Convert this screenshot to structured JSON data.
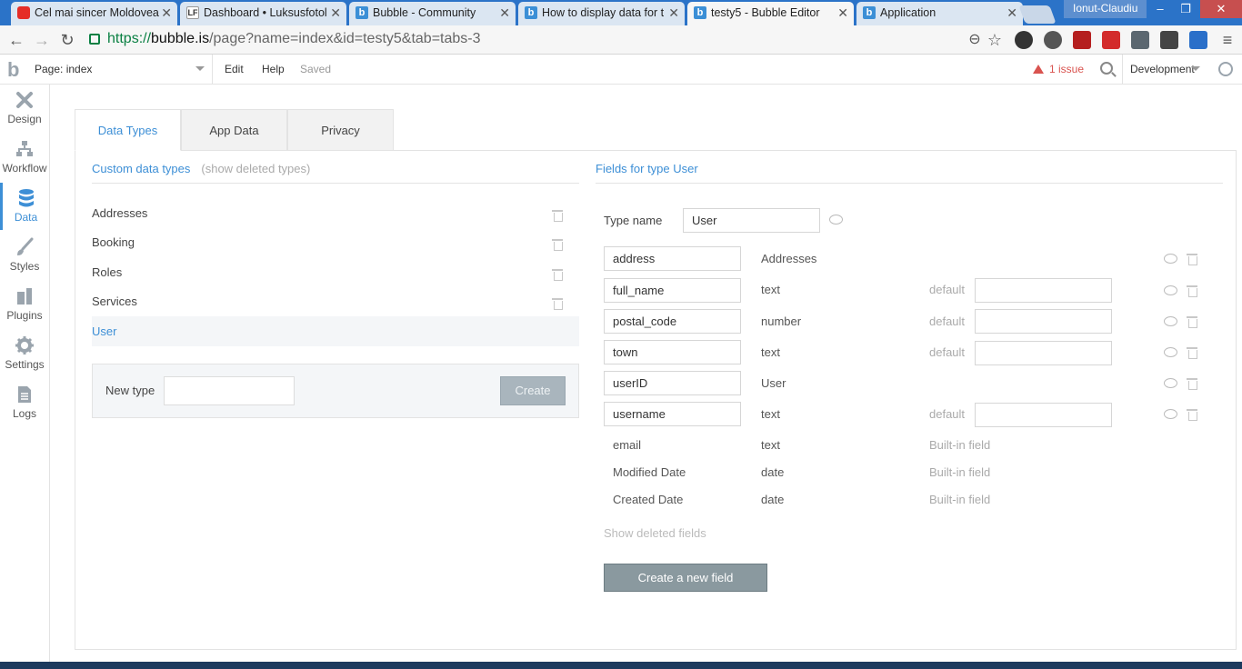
{
  "browser": {
    "tabs": [
      {
        "title": "Cel mai sincer Moldovea",
        "favicon": "youtube-icon"
      },
      {
        "title": "Dashboard • Luksusfotol",
        "favicon": "lf-icon"
      },
      {
        "title": "Bubble - Community",
        "favicon": "bubble-icon"
      },
      {
        "title": "How to display data for t",
        "favicon": "bubble-icon"
      },
      {
        "title": "testy5 - Bubble Editor",
        "favicon": "bubble-icon",
        "active": true
      },
      {
        "title": "Application",
        "favicon": "bubble-icon"
      }
    ],
    "profile_name": "Ionut-Claudiu",
    "url_scheme": "https://",
    "url_host": "bubble.is",
    "url_rest": "/page?name=index&id=testy5&tab=tabs-3"
  },
  "header": {
    "page_selector": "Page: index",
    "menu_edit": "Edit",
    "menu_help": "Help",
    "status": "Saved",
    "issues": "1 issue",
    "environment": "Development"
  },
  "sidebar": {
    "items": [
      {
        "label": "Design",
        "icon": "design-icon"
      },
      {
        "label": "Workflow",
        "icon": "workflow-icon"
      },
      {
        "label": "Data",
        "icon": "database-icon",
        "active": true
      },
      {
        "label": "Styles",
        "icon": "brush-icon"
      },
      {
        "label": "Plugins",
        "icon": "plugins-icon"
      },
      {
        "label": "Settings",
        "icon": "gear-icon"
      },
      {
        "label": "Logs",
        "icon": "logs-icon"
      }
    ]
  },
  "main": {
    "tabs": [
      "Data Types",
      "App Data",
      "Privacy"
    ],
    "active_tab": "Data Types",
    "left": {
      "heading": "Custom data types",
      "show_deleted": "(show deleted types)",
      "types": [
        "Addresses",
        "Booking",
        "Roles",
        "Services",
        "User"
      ],
      "selected_type": "User",
      "new_type_label": "New type",
      "new_type_value": "",
      "create_button": "Create"
    },
    "right": {
      "heading": "Fields for type User",
      "type_name_label": "Type name",
      "type_name_value": "User",
      "fields": [
        {
          "name": "address",
          "type": "Addresses",
          "default_label": "",
          "has_default": false
        },
        {
          "name": "full_name",
          "type": "text",
          "default_label": "default",
          "has_default": true
        },
        {
          "name": "postal_code",
          "type": "number",
          "default_label": "default",
          "has_default": true
        },
        {
          "name": "town",
          "type": "text",
          "default_label": "default",
          "has_default": true
        },
        {
          "name": "userID",
          "type": "User",
          "default_label": "",
          "has_default": false
        },
        {
          "name": "username",
          "type": "text",
          "default_label": "default",
          "has_default": true
        }
      ],
      "builtin_fields": [
        {
          "name": "email",
          "type": "text",
          "note": "Built-in field"
        },
        {
          "name": "Modified Date",
          "type": "date",
          "note": "Built-in field"
        },
        {
          "name": "Created Date",
          "type": "date",
          "note": "Built-in field"
        }
      ],
      "show_deleted_fields": "Show deleted fields",
      "create_field_button": "Create a new field"
    }
  },
  "colors": {
    "accent": "#3d8fd6",
    "browser_frame": "#2b73c8",
    "issue": "#d9534f",
    "create_field_button": "#8a999f"
  }
}
